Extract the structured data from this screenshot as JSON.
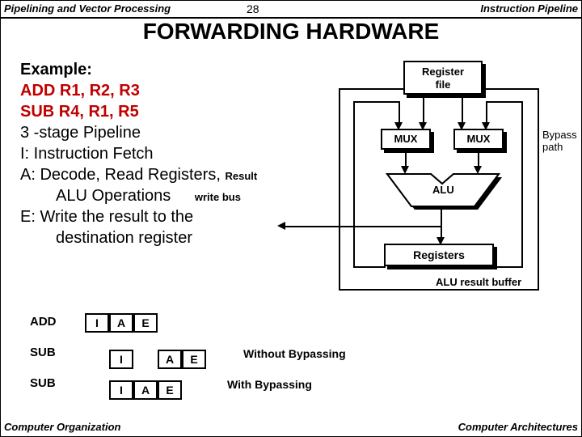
{
  "header": {
    "left": "Pipelining and Vector Processing",
    "page": "28",
    "right": "Instruction Pipeline"
  },
  "title": "FORWARDING  HARDWARE",
  "example": {
    "label": "Example:",
    "line1": "ADD   R1, R2, R3",
    "line2": "SUB   R4, R1, R5",
    "line3": "3 -stage Pipeline",
    "line4": "I:  Instruction Fetch",
    "line5a": "A: Decode, Read Registers,",
    "line5b": "Result",
    "line6a": "ALU Operations",
    "line6b": "write bus",
    "line7": "E: Write the result to the",
    "line8": "destination register"
  },
  "diagram": {
    "regfile": "Register\nfile",
    "mux1": "MUX",
    "mux2": "MUX",
    "alu": "ALU",
    "registers": "Registers",
    "bypass": "Bypass\npath",
    "alubuf": "ALU result buffer"
  },
  "timing": {
    "row1_label": "ADD",
    "row2_label": "SUB",
    "row3_label": "SUB",
    "cells": {
      "I": "I",
      "A": "A",
      "E": "E"
    },
    "note1": "Without Bypassing",
    "note2": "With Bypassing"
  },
  "footer": {
    "left": "Computer Organization",
    "right": "Computer Architectures"
  }
}
